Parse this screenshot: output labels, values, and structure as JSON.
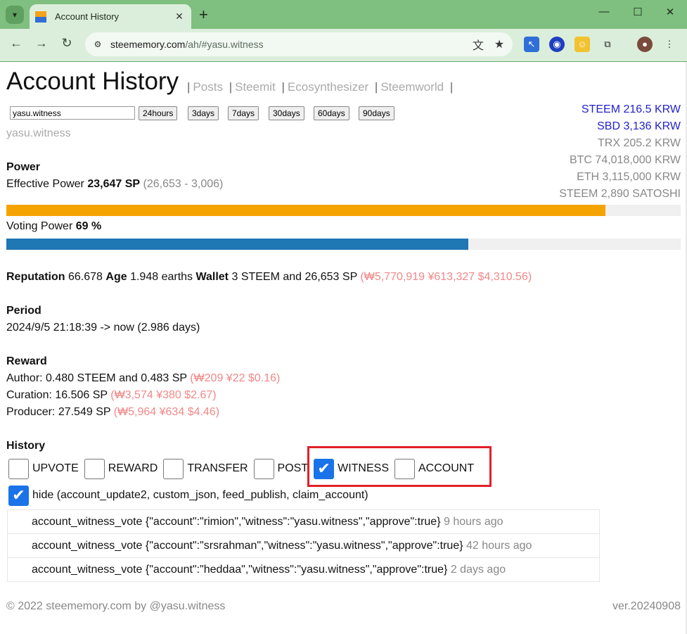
{
  "browser": {
    "tab_title": "Account History",
    "url_host": "steememory.com",
    "url_path": "/ah/#yasu.witness"
  },
  "page": {
    "title": "Account History",
    "nav_links": [
      "Posts",
      "Steemit",
      "Ecosynthesizer",
      "Steemworld"
    ],
    "account_input_value": "yasu.witness",
    "range_buttons": [
      "24hours",
      "3days",
      "7days",
      "30days",
      "60days",
      "90days"
    ],
    "account_name": "yasu.witness",
    "prices": [
      {
        "text": "STEEM 216.5 KRW",
        "color": "#2222cc"
      },
      {
        "text": "SBD 3,136 KRW",
        "color": "#2222cc"
      },
      {
        "text": "TRX 205.2 KRW",
        "color": "#888888"
      },
      {
        "text": "BTC 74,018,000 KRW",
        "color": "#888888"
      },
      {
        "text": "ETH 3,115,000 KRW",
        "color": "#888888"
      },
      {
        "text": "STEEM 2,890 SATOSHI",
        "color": "#888888"
      }
    ],
    "power": {
      "heading": "Power",
      "effective_label": "Effective Power",
      "effective_value": "23,647 SP",
      "effective_detail": "(26,653 - 3,006)",
      "effective_fill_pct": 88.8,
      "effective_color": "#f5a300",
      "voting_label": "Voting Power",
      "voting_value": "69 %",
      "voting_fill_pct": 68.5,
      "voting_color": "#1f77b4"
    },
    "stats": {
      "reputation_label": "Reputation",
      "reputation_value": "66.678",
      "age_label": "Age",
      "age_value": "1.948 earths",
      "wallet_label": "Wallet",
      "wallet_value": "3 STEEM and 26,653 SP",
      "wallet_krw": "(₩5,770,919",
      "wallet_jpy": "¥613,327",
      "wallet_usd": "$4,310.56)"
    },
    "period": {
      "heading": "Period",
      "value": "2024/9/5 21:18:39 -> now (2.986 days)"
    },
    "reward": {
      "heading": "Reward",
      "author_text": "Author: 0.480 STEEM and 0.483 SP",
      "author_fiat": [
        "(₩209",
        "¥22",
        "$0.16)"
      ],
      "curation_text": "Curation: 16.506 SP",
      "curation_fiat": [
        "(₩3,574",
        "¥380",
        "$2.67)"
      ],
      "producer_text": "Producer: 27.549 SP",
      "producer_fiat": [
        "(₩5,964",
        "¥634",
        "$4.46)"
      ]
    },
    "history": {
      "heading": "History",
      "filters": [
        {
          "label": "UPVOTE",
          "checked": false
        },
        {
          "label": "REWARD",
          "checked": false
        },
        {
          "label": "TRANSFER",
          "checked": false
        },
        {
          "label": "POST",
          "checked": false
        },
        {
          "label": "WITNESS",
          "checked": true
        },
        {
          "label": "ACCOUNT",
          "checked": false
        }
      ],
      "hide_label": "hide (account_update2, custom_json, feed_publish, claim_account)",
      "hide_checked": true,
      "rows": [
        {
          "op": "account_witness_vote",
          "json": "{\"account\":\"rimion\",\"witness\":\"yasu.witness\",\"approve\":true}",
          "time": "9 hours ago"
        },
        {
          "op": "account_witness_vote",
          "json": "{\"account\":\"srsrahman\",\"witness\":\"yasu.witness\",\"approve\":true}",
          "time": "42 hours ago"
        },
        {
          "op": "account_witness_vote",
          "json": "{\"account\":\"heddaa\",\"witness\":\"yasu.witness\",\"approve\":true}",
          "time": "2 days ago"
        }
      ]
    },
    "footer": {
      "copyright": "© 2022 steememory.com by @yasu.witness",
      "version": "ver.20240908"
    }
  }
}
